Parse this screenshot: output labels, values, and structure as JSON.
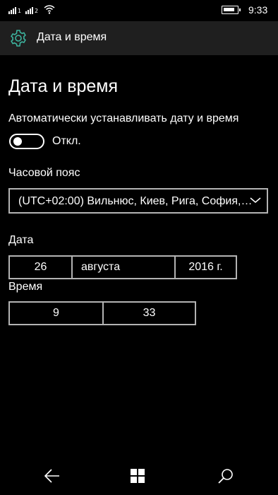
{
  "status_bar": {
    "sim1_label": "1",
    "sim2_label": "2",
    "time": "9:33"
  },
  "header": {
    "title": "Дата и время",
    "icon": "gear-icon"
  },
  "page": {
    "title": "Дата и время"
  },
  "auto_set": {
    "label": "Автоматически устанавливать дату и время",
    "state": "Откл.",
    "on": false
  },
  "timezone": {
    "label": "Часовой пояс",
    "value": "(UTC+02:00) Вильнюс, Киев, Рига, София,…"
  },
  "date": {
    "label": "Дата",
    "day": "26",
    "month": "августа",
    "year": "2016 г."
  },
  "time": {
    "label": "Время",
    "hour": "9",
    "minute": "33"
  },
  "colors": {
    "background": "#000000",
    "header_bg": "#1f1f1f",
    "accent": "#3db39e",
    "border": "#b3b3b3"
  }
}
